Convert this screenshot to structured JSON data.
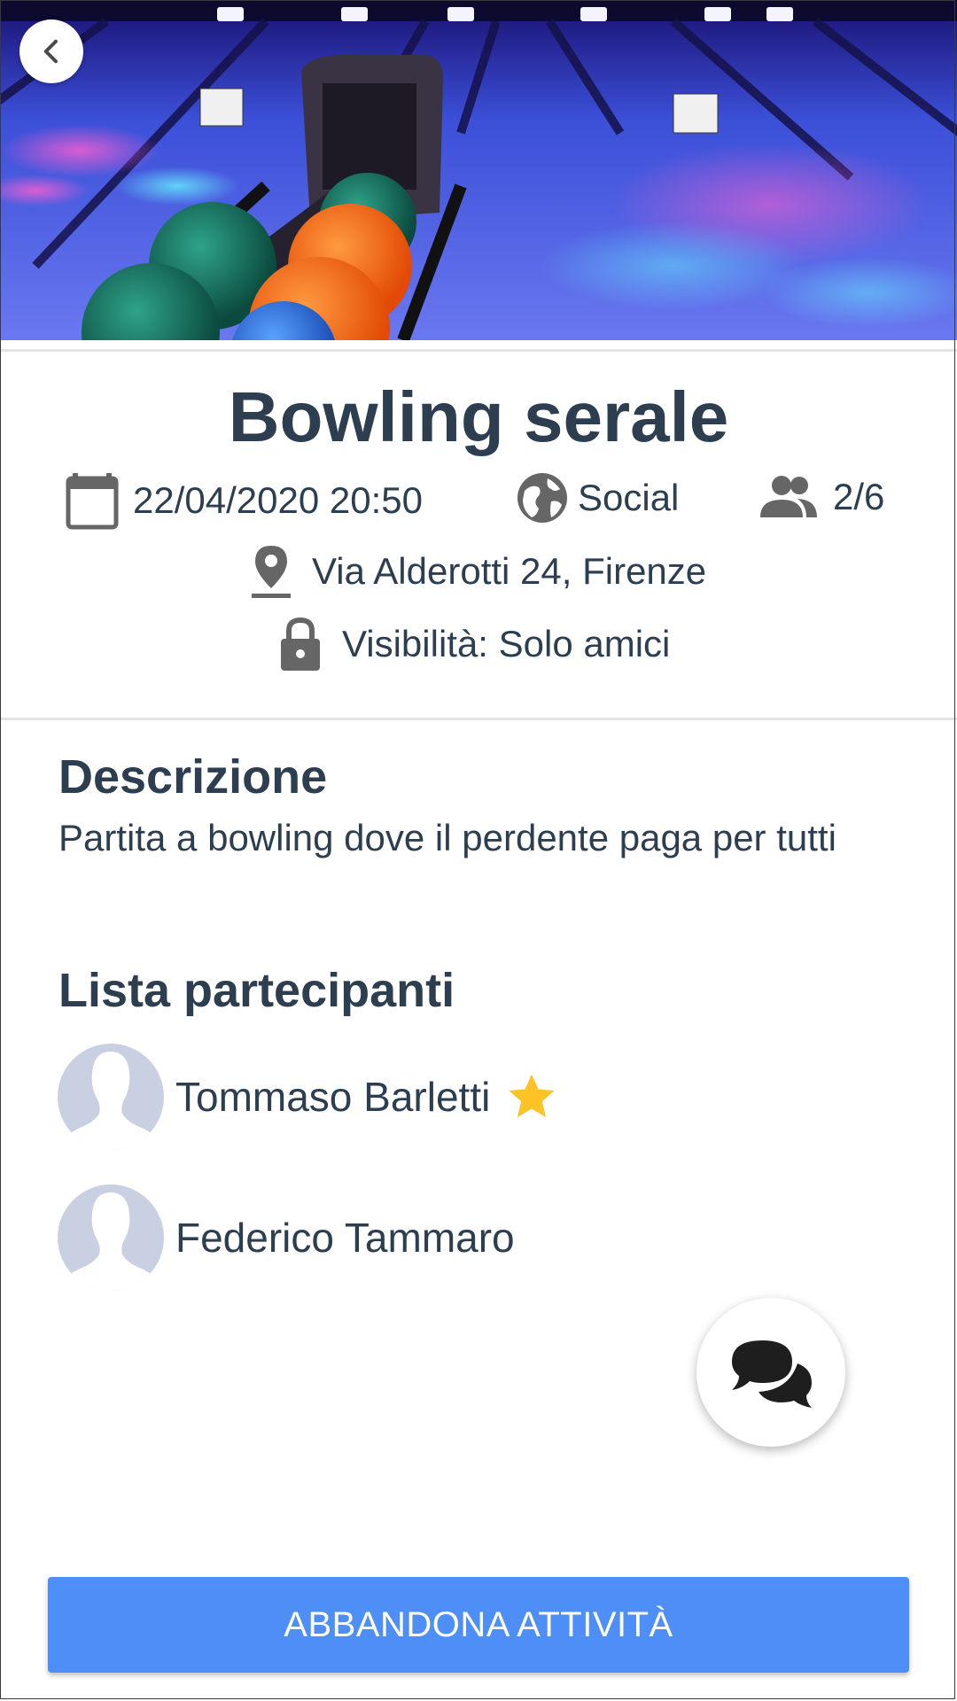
{
  "activity": {
    "title": "Bowling serale",
    "date": "22/04/2020 20:50",
    "category": "Social",
    "participants_count": "2/6",
    "location": "Via Alderotti 24, Firenze",
    "visibility": "Visibilità: Solo amici"
  },
  "description": {
    "heading": "Descrizione",
    "text": "Partita a bowling dove il perdente paga per tutti"
  },
  "participants": {
    "heading": "Lista partecipanti",
    "items": [
      {
        "name": "Tommaso Barletti",
        "organizer": true
      },
      {
        "name": "Federico Tammaro",
        "organizer": false
      }
    ]
  },
  "actions": {
    "leave_label": "ABBANDONA ATTIVITÀ"
  },
  "icons": {
    "back": "chevron-left-icon",
    "date": "calendar-icon",
    "category": "globe-icon",
    "participants": "people-icon",
    "location": "map-pin-icon",
    "visibility": "lock-icon",
    "organizer": "star-icon",
    "chat": "chat-bubbles-icon"
  },
  "colors": {
    "primary_button": "#4d8ff7",
    "text": "#2c3e50",
    "icon_gray": "#666666",
    "star": "#fcc326",
    "avatar": "#c9d0e2"
  }
}
